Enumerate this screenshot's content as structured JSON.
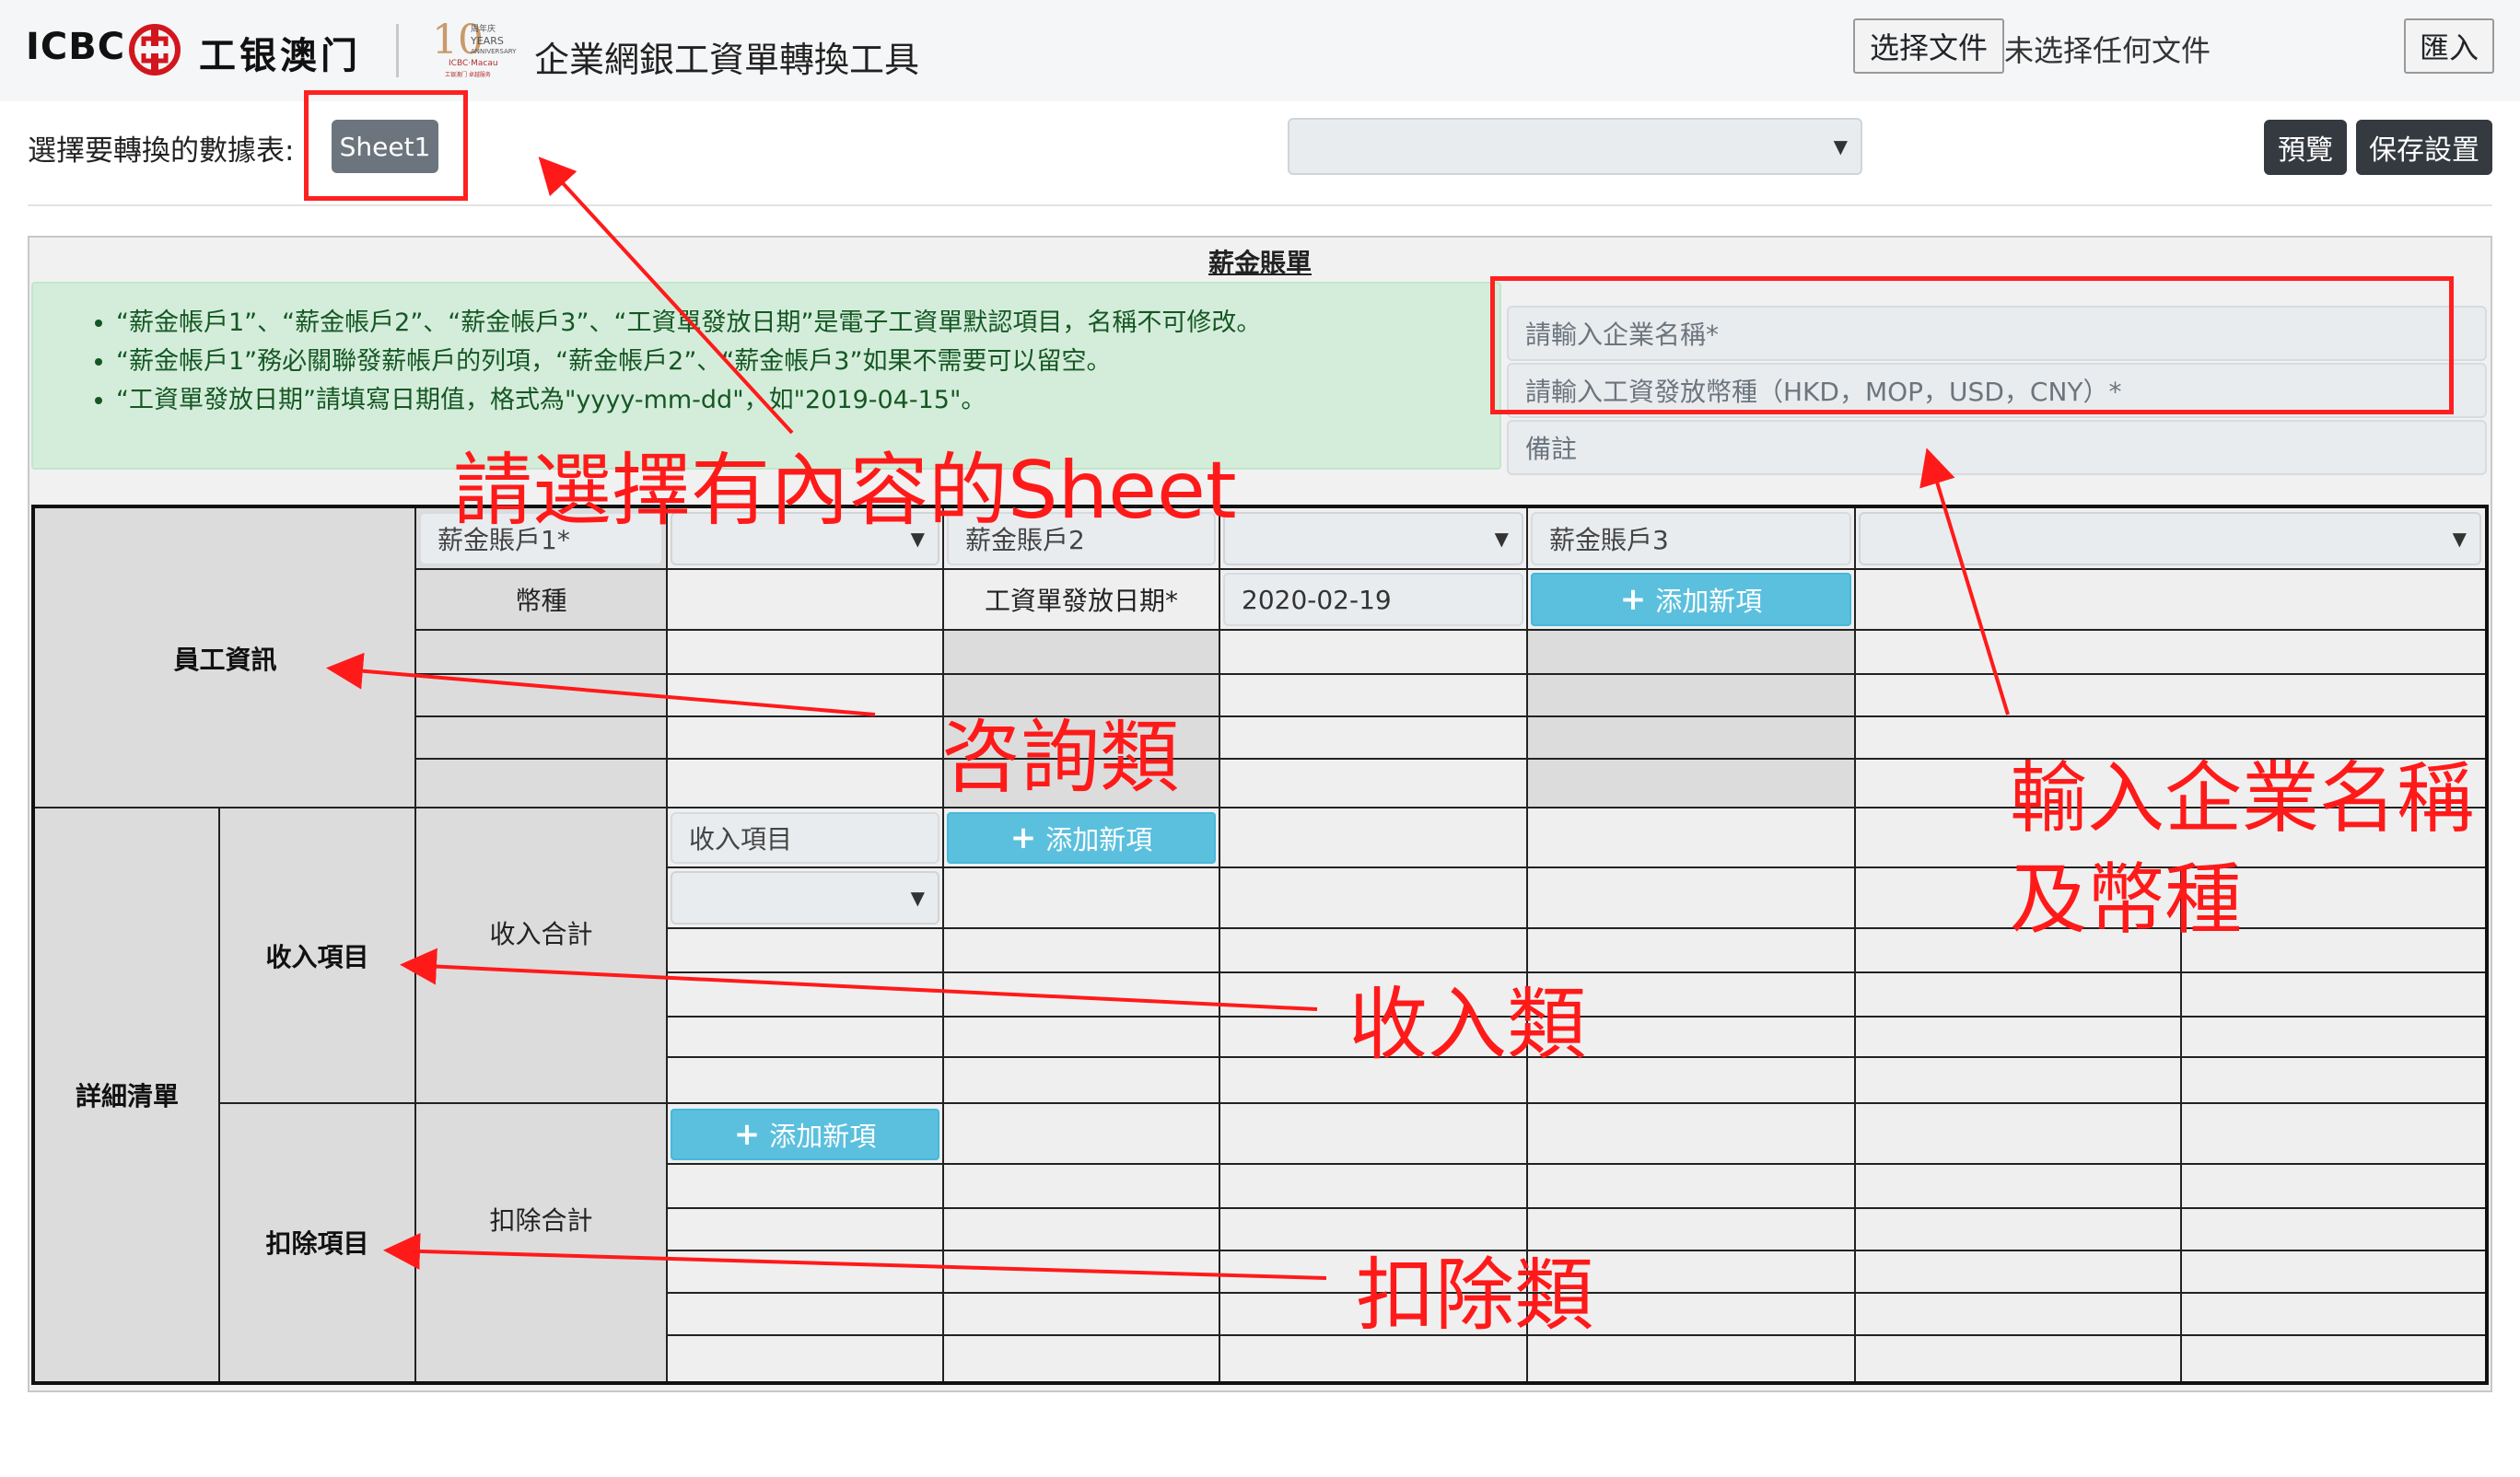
{
  "header": {
    "icbc": "ICBC",
    "bank_cn": "工银澳门",
    "anniv_num": "10",
    "anniv_small": "周年庆",
    "anniv_years": "YEARS",
    "anniv_anniversary": "ANNIVERSARY",
    "anniv_macau": "ICBC·Macau",
    "anniv_tag": "工银澳门 卓越服务",
    "title": "企業網銀工資單轉換工具",
    "choose_file": "选择文件",
    "no_file": "未选择任何文件",
    "import": "匯入"
  },
  "toolbar": {
    "sheet_label": "選擇要轉換的數據表:",
    "sheet_button": "Sheet1",
    "preview": "預覽",
    "save_settings": "保存設置"
  },
  "panel": {
    "title": "薪金賬單",
    "notes": [
      "“薪金帳戶1”、“薪金帳戶2”、“薪金帳戶3”、“工資單發放日期”是電子工資單默認項目，名稱不可修改。",
      "“薪金帳戶1”務必關聯發薪帳戶的列項，“薪金帳戶2”、“薪金帳戶3”如果不需要可以留空。",
      "“工資單發放日期”請填寫日期值，格式為\"yyyy-mm-dd\"，如\"2019-04-15\"。"
    ],
    "company_placeholder": "請輸入企業名稱*",
    "currency_placeholder": "請輸入工資發放幣種（HKD，MOP，USD，CNY）*",
    "remark_placeholder": "備註"
  },
  "table": {
    "account1": "薪金賬戶1*",
    "account2": "薪金賬戶2",
    "account3": "薪金賬戶3",
    "currency": "幣種",
    "pay_date_label": "工資單發放日期*",
    "pay_date_value": "2020-02-19",
    "add_new": "添加新項",
    "employee_info": "員工資訊",
    "details": "詳細清單",
    "income_items": "收入項目",
    "income_item_input": "收入項目",
    "income_total": "收入合計",
    "deduction_items": "扣除項目",
    "deduction_total": "扣除合計"
  },
  "annotations": {
    "sheet": "請選擇有內容的Sheet",
    "inquiry": "咨詢類",
    "company": "輸入企業名稱",
    "currency": "及幣種",
    "income": "收入類",
    "deduction": "扣除類"
  },
  "colors": {
    "annotation": "#ff1a1a",
    "info_button": "#5bc0de",
    "dark_button": "#343a40",
    "note_bg": "#d4edda"
  }
}
